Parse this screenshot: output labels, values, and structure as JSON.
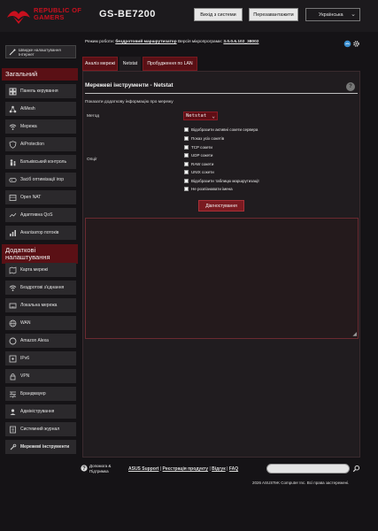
{
  "header": {
    "brand_line1": "REPUBLIC OF",
    "brand_line2": "GAMERS",
    "model": "GS-BE7200",
    "logout_label": "Вихід з системи",
    "reboot_label": "Перезавантажити",
    "language": "Українська"
  },
  "sidebar": {
    "quick_setup": "Швидке налаштування Інтернет",
    "general_heading": "Загальний",
    "general_items": [
      {
        "label": "Панель керування",
        "icon": "dashboard-icon"
      },
      {
        "label": "AiMesh",
        "icon": "aimesh-icon"
      },
      {
        "label": "Мережа",
        "icon": "network-icon"
      },
      {
        "label": "AiProtection",
        "icon": "shield-icon"
      },
      {
        "label": "Батьківський контроль",
        "icon": "parental-icon"
      },
      {
        "label": "Засіб оптимізації ігор",
        "icon": "gamepad-icon"
      },
      {
        "label": "Open NAT",
        "icon": "nat-icon"
      },
      {
        "label": "Адаптивна QoS",
        "icon": "qos-icon"
      },
      {
        "label": "Аналізатор потоків",
        "icon": "traffic-icon"
      }
    ],
    "advanced_heading": "Додаткові налаштування",
    "advanced_items": [
      {
        "label": "Карта мережі",
        "icon": "map-icon"
      },
      {
        "label": "Бездротові з'єднання",
        "icon": "wifi-icon"
      },
      {
        "label": "Локальна мережа",
        "icon": "lan-icon"
      },
      {
        "label": "WAN",
        "icon": "globe-icon"
      },
      {
        "label": "Amazon Alexa",
        "icon": "alexa-icon"
      },
      {
        "label": "IPv6",
        "icon": "ipv6-icon"
      },
      {
        "label": "VPN",
        "icon": "vpn-icon"
      },
      {
        "label": "Брандмауер",
        "icon": "firewall-icon"
      },
      {
        "label": "Адміністрування",
        "icon": "admin-icon"
      },
      {
        "label": "Системний журнал",
        "icon": "log-icon"
      },
      {
        "label": "Мережеві інструменти",
        "icon": "tools-icon"
      }
    ]
  },
  "status": {
    "mode_label": "Режим роботи:",
    "mode_value": "бездротовий маршрутизатор",
    "firmware_label": "Версія мікропрограми:",
    "firmware_value": "3.0.0.6.102_38002"
  },
  "tabs": [
    {
      "label": "Аналіз мережі",
      "active": false
    },
    {
      "label": "Netstat",
      "active": true
    },
    {
      "label": "Пробудження по LAN",
      "active": false
    }
  ],
  "content": {
    "title": "Мережеві інструменти - Netstat",
    "description": "Показати додаткову інформацію про мережу",
    "method_label": "Метод",
    "method_value": "Netstat",
    "options_label": "Опції",
    "options": [
      "Відобразити активні сокети сервера",
      "Показ усіх сокетів",
      "TCP сокети",
      "UDP сокети",
      "RAW сокети",
      "UNIX сокети",
      "Відобразити таблицю маршрутизації",
      "Не розпізнавати імена"
    ],
    "diagnose_label": "Діагностування",
    "output": ""
  },
  "footer": {
    "help_line1": "Допомога &",
    "help_line2": "Підтримка",
    "link_support": "ASUS Support",
    "link_register": "Реєстрація продукту",
    "link_feedback": "Відгук",
    "link_faq": "FAQ",
    "separator": "|",
    "search_value": "",
    "copyright": "2026 ASUSTeK Computer Inc. Всі права застережені."
  },
  "colors": {
    "background": "#151316",
    "accent_red": "#c8101e",
    "section_red": "#5a1015",
    "button_red": "#7a1a20"
  }
}
